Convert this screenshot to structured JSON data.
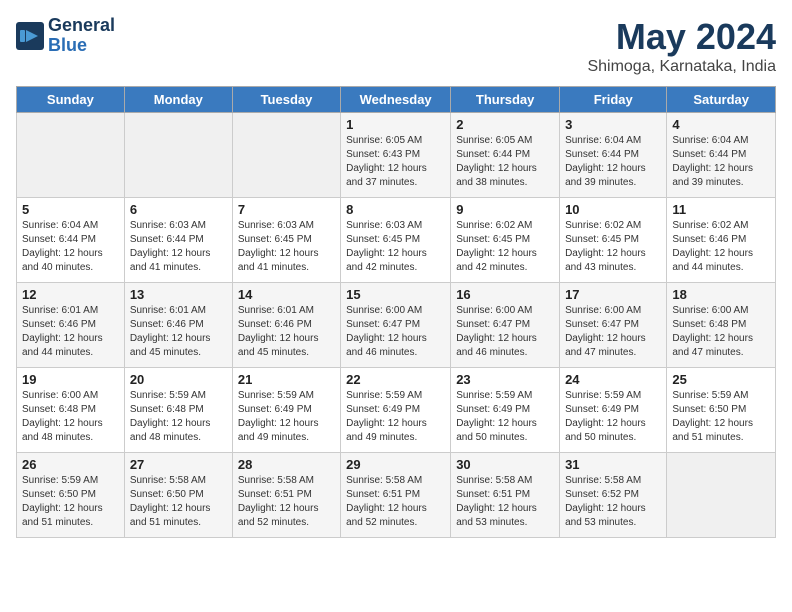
{
  "logo": {
    "line1": "General",
    "line2": "Blue"
  },
  "title": "May 2024",
  "subtitle": "Shimoga, Karnataka, India",
  "days_of_week": [
    "Sunday",
    "Monday",
    "Tuesday",
    "Wednesday",
    "Thursday",
    "Friday",
    "Saturday"
  ],
  "weeks": [
    [
      {
        "day": "",
        "info": ""
      },
      {
        "day": "",
        "info": ""
      },
      {
        "day": "",
        "info": ""
      },
      {
        "day": "1",
        "info": "Sunrise: 6:05 AM\nSunset: 6:43 PM\nDaylight: 12 hours and 37 minutes."
      },
      {
        "day": "2",
        "info": "Sunrise: 6:05 AM\nSunset: 6:44 PM\nDaylight: 12 hours and 38 minutes."
      },
      {
        "day": "3",
        "info": "Sunrise: 6:04 AM\nSunset: 6:44 PM\nDaylight: 12 hours and 39 minutes."
      },
      {
        "day": "4",
        "info": "Sunrise: 6:04 AM\nSunset: 6:44 PM\nDaylight: 12 hours and 39 minutes."
      }
    ],
    [
      {
        "day": "5",
        "info": "Sunrise: 6:04 AM\nSunset: 6:44 PM\nDaylight: 12 hours and 40 minutes."
      },
      {
        "day": "6",
        "info": "Sunrise: 6:03 AM\nSunset: 6:44 PM\nDaylight: 12 hours and 41 minutes."
      },
      {
        "day": "7",
        "info": "Sunrise: 6:03 AM\nSunset: 6:45 PM\nDaylight: 12 hours and 41 minutes."
      },
      {
        "day": "8",
        "info": "Sunrise: 6:03 AM\nSunset: 6:45 PM\nDaylight: 12 hours and 42 minutes."
      },
      {
        "day": "9",
        "info": "Sunrise: 6:02 AM\nSunset: 6:45 PM\nDaylight: 12 hours and 42 minutes."
      },
      {
        "day": "10",
        "info": "Sunrise: 6:02 AM\nSunset: 6:45 PM\nDaylight: 12 hours and 43 minutes."
      },
      {
        "day": "11",
        "info": "Sunrise: 6:02 AM\nSunset: 6:46 PM\nDaylight: 12 hours and 44 minutes."
      }
    ],
    [
      {
        "day": "12",
        "info": "Sunrise: 6:01 AM\nSunset: 6:46 PM\nDaylight: 12 hours and 44 minutes."
      },
      {
        "day": "13",
        "info": "Sunrise: 6:01 AM\nSunset: 6:46 PM\nDaylight: 12 hours and 45 minutes."
      },
      {
        "day": "14",
        "info": "Sunrise: 6:01 AM\nSunset: 6:46 PM\nDaylight: 12 hours and 45 minutes."
      },
      {
        "day": "15",
        "info": "Sunrise: 6:00 AM\nSunset: 6:47 PM\nDaylight: 12 hours and 46 minutes."
      },
      {
        "day": "16",
        "info": "Sunrise: 6:00 AM\nSunset: 6:47 PM\nDaylight: 12 hours and 46 minutes."
      },
      {
        "day": "17",
        "info": "Sunrise: 6:00 AM\nSunset: 6:47 PM\nDaylight: 12 hours and 47 minutes."
      },
      {
        "day": "18",
        "info": "Sunrise: 6:00 AM\nSunset: 6:48 PM\nDaylight: 12 hours and 47 minutes."
      }
    ],
    [
      {
        "day": "19",
        "info": "Sunrise: 6:00 AM\nSunset: 6:48 PM\nDaylight: 12 hours and 48 minutes."
      },
      {
        "day": "20",
        "info": "Sunrise: 5:59 AM\nSunset: 6:48 PM\nDaylight: 12 hours and 48 minutes."
      },
      {
        "day": "21",
        "info": "Sunrise: 5:59 AM\nSunset: 6:49 PM\nDaylight: 12 hours and 49 minutes."
      },
      {
        "day": "22",
        "info": "Sunrise: 5:59 AM\nSunset: 6:49 PM\nDaylight: 12 hours and 49 minutes."
      },
      {
        "day": "23",
        "info": "Sunrise: 5:59 AM\nSunset: 6:49 PM\nDaylight: 12 hours and 50 minutes."
      },
      {
        "day": "24",
        "info": "Sunrise: 5:59 AM\nSunset: 6:49 PM\nDaylight: 12 hours and 50 minutes."
      },
      {
        "day": "25",
        "info": "Sunrise: 5:59 AM\nSunset: 6:50 PM\nDaylight: 12 hours and 51 minutes."
      }
    ],
    [
      {
        "day": "26",
        "info": "Sunrise: 5:59 AM\nSunset: 6:50 PM\nDaylight: 12 hours and 51 minutes."
      },
      {
        "day": "27",
        "info": "Sunrise: 5:58 AM\nSunset: 6:50 PM\nDaylight: 12 hours and 51 minutes."
      },
      {
        "day": "28",
        "info": "Sunrise: 5:58 AM\nSunset: 6:51 PM\nDaylight: 12 hours and 52 minutes."
      },
      {
        "day": "29",
        "info": "Sunrise: 5:58 AM\nSunset: 6:51 PM\nDaylight: 12 hours and 52 minutes."
      },
      {
        "day": "30",
        "info": "Sunrise: 5:58 AM\nSunset: 6:51 PM\nDaylight: 12 hours and 53 minutes."
      },
      {
        "day": "31",
        "info": "Sunrise: 5:58 AM\nSunset: 6:52 PM\nDaylight: 12 hours and 53 minutes."
      },
      {
        "day": "",
        "info": ""
      }
    ]
  ]
}
